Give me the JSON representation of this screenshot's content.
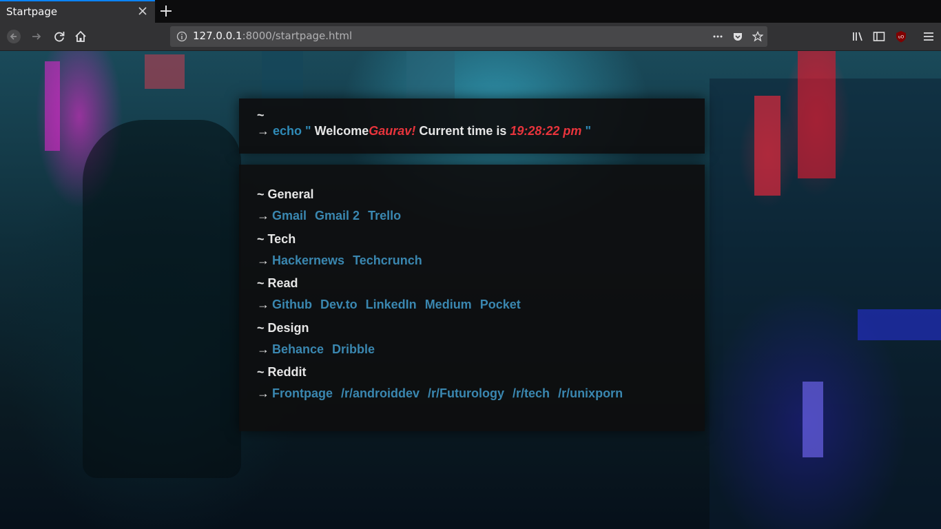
{
  "browser": {
    "tab_title": "Startpage",
    "url_host": "127.0.0.1",
    "url_rest": ":8000/startpage.html"
  },
  "header": {
    "tilde": "~",
    "arrow": "→",
    "cmd": "echo \"",
    "welcome": "Welcome",
    "user": "Gaurav!",
    "time_label": "Current time is",
    "time": "19:28:22 pm",
    "quote_close": "\""
  },
  "sections": [
    {
      "title": "~ General",
      "links": [
        "Gmail",
        "Gmail 2",
        "Trello"
      ]
    },
    {
      "title": "~ Tech",
      "links": [
        "Hackernews",
        "Techcrunch"
      ]
    },
    {
      "title": "~ Read",
      "links": [
        "Github",
        "Dev.to",
        "LinkedIn",
        "Medium",
        "Pocket"
      ]
    },
    {
      "title": "~ Design",
      "links": [
        "Behance",
        "Dribble"
      ]
    },
    {
      "title": "~ Reddit",
      "links": [
        "Frontpage",
        "/r/androiddev",
        "/r/Futurology",
        "/r/tech",
        "/r/unixporn"
      ]
    }
  ],
  "colors": {
    "accent": "#2f8bb8",
    "highlight": "#e8343c",
    "tab_accent": "#0a84ff"
  },
  "icons": [
    "close-icon",
    "plus-icon",
    "back-icon",
    "forward-icon",
    "reload-icon",
    "home-icon",
    "info-icon",
    "more-icon",
    "pocket-icon",
    "bookmark-star-icon",
    "library-icon",
    "sidebar-icon",
    "ublock-icon",
    "menu-icon"
  ]
}
